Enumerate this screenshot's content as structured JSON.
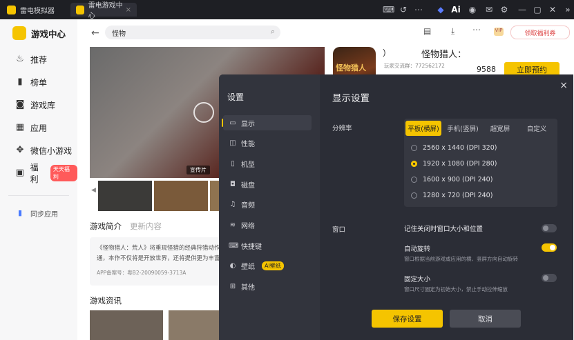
{
  "titlebar": {
    "tabs": [
      {
        "label": "雷电模拟器"
      },
      {
        "label": "雷电游戏中心",
        "close": "×"
      }
    ]
  },
  "sidebar": {
    "title": "游戏中心",
    "items": [
      {
        "label": "推荐",
        "icon": "fire-icon"
      },
      {
        "label": "榜单",
        "icon": "bar-chart-icon"
      },
      {
        "label": "游戏库",
        "icon": "gamepad-icon"
      },
      {
        "label": "应用",
        "icon": "apps-grid-icon"
      },
      {
        "label": "微信小游戏",
        "icon": "wechat-mini-icon"
      },
      {
        "label": "福利",
        "icon": "gift-icon",
        "badge": "天天福利"
      }
    ],
    "sync": "同步应用"
  },
  "main": {
    "search_value": "怪物",
    "gift_label": "领取福利券",
    "game_title": "怪物猎人：",
    "game_title_prefix": "）",
    "player_group": "玩家交流群：772562172",
    "stat": "9588",
    "reserve_label": "立即预约",
    "media_tag": "宣传片",
    "tabs": [
      "游戏简介",
      "更新内容"
    ],
    "intro_text": "《怪物猎人：荒人》将重现怪猎的经典狩猎动作，",
    "intro_text2": "通，本作不仅将是开放世界，还将提供更为丰富的",
    "app_record": "APP备案号：粤B2-20090059-3713A",
    "news_title": "游戏资讯",
    "cover_text": "怪物猎人"
  },
  "dialog": {
    "title": "设置",
    "close": "×",
    "section_title": "显示设置",
    "nav": [
      {
        "label": "显示",
        "icon": "monitor-icon"
      },
      {
        "label": "性能",
        "icon": "performance-icon"
      },
      {
        "label": "机型",
        "icon": "phone-icon"
      },
      {
        "label": "磁盘",
        "icon": "disk-icon"
      },
      {
        "label": "音频",
        "icon": "audio-icon"
      },
      {
        "label": "网络",
        "icon": "wifi-icon"
      },
      {
        "label": "快捷键",
        "icon": "keyboard-icon"
      },
      {
        "label": "壁纸",
        "icon": "palette-icon",
        "badge": "AI壁纸"
      },
      {
        "label": "其他",
        "icon": "more-grid-icon"
      }
    ],
    "resolution_label": "分辨率",
    "resolution_tabs": [
      "平板(横屏)",
      "手机(竖屏)",
      "超宽屏",
      "自定义"
    ],
    "resolutions": [
      {
        "label": "2560 x 1440  (DPI 320)",
        "selected": false
      },
      {
        "label": "1920 x 1080  (DPI 280)",
        "selected": true
      },
      {
        "label": "1600 x 900  (DPI 240)",
        "selected": false
      },
      {
        "label": "1280 x 720  (DPI 240)",
        "selected": false
      }
    ],
    "window_label": "窗口",
    "window_options": [
      {
        "label": "记住关闭时窗口大小和位置",
        "desc": "",
        "on": false
      },
      {
        "label": "自动旋转",
        "desc": "窗口根据当前游戏或应用的横、竖屏方向自动旋转",
        "on": true
      },
      {
        "label": "固定大小",
        "desc": "窗口尺寸固定为初始大小，禁止手动拉伸缩放",
        "on": false
      }
    ],
    "save_label": "保存设置",
    "cancel_label": "取消"
  },
  "colors": {
    "accent": "#f5c400",
    "dialog_bg": "#2b2d36"
  }
}
